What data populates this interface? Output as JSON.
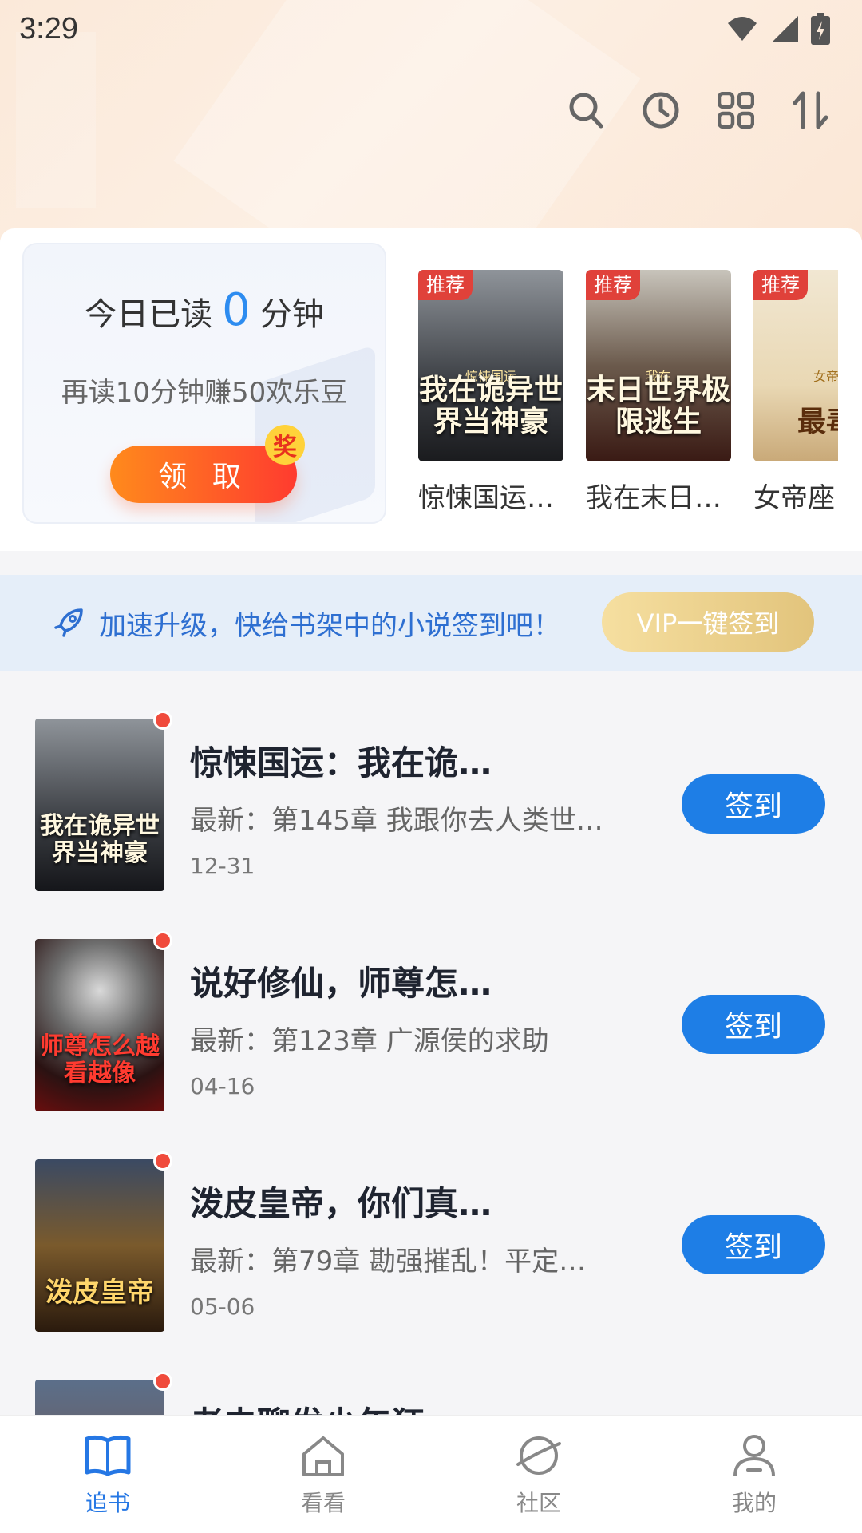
{
  "status_bar": {
    "time": "3:29"
  },
  "toolbar": {
    "icons": [
      "search-icon",
      "history-clock-icon",
      "grid-icon",
      "sort-icon"
    ]
  },
  "today_card": {
    "prefix": "今日已读",
    "minutes": "0",
    "suffix": "分钟",
    "subtitle": "再读10分钟赚50欢乐豆",
    "claim_label": "领 取",
    "badge": "奖"
  },
  "recommended": [
    {
      "tag": "推荐",
      "title": "惊悚国运…",
      "cover_text": "我在诡异世界当神豪",
      "cover_small": "惊悚国运"
    },
    {
      "tag": "推荐",
      "title": "我在末日…",
      "cover_text": "末日世界极限逃生",
      "cover_small": "我在"
    },
    {
      "tag": "推荐",
      "title": "女帝座",
      "cover_text": "最毒",
      "cover_small": "女帝"
    }
  ],
  "vip_banner": {
    "text": "加速升级，快给书架中的小说签到吧！",
    "button": "VIP一键签到"
  },
  "shelf": [
    {
      "title": "惊悚国运：我在诡…",
      "latest": "最新：第145章 我跟你去人类世…",
      "date": "12-31",
      "button": "签到",
      "cover_text": "我在诡异世界当神豪"
    },
    {
      "title": "说好修仙，师尊怎…",
      "latest": "最新：第123章  广源侯的求助",
      "date": "04-16",
      "button": "签到",
      "cover_text": "师尊怎么越看越像"
    },
    {
      "title": "泼皮皇帝，你们真…",
      "latest": "最新：第79章 勘强摧乱！平定…",
      "date": "05-06",
      "button": "签到",
      "cover_text": "泼皮皇帝"
    },
    {
      "title": "老夫聊发少年狂",
      "latest": "",
      "date": "",
      "button": "",
      "cover_text": ""
    }
  ],
  "bottom_nav": [
    {
      "label": "追书",
      "icon": "book-icon",
      "active": true
    },
    {
      "label": "看看",
      "icon": "home-icon",
      "active": false
    },
    {
      "label": "社区",
      "icon": "planet-icon",
      "active": false
    },
    {
      "label": "我的",
      "icon": "profile-icon",
      "active": false
    }
  ],
  "colors": {
    "accent": "#1e7ee6",
    "orange": "#ff6a23",
    "vip_gold": "#e2c47c"
  }
}
